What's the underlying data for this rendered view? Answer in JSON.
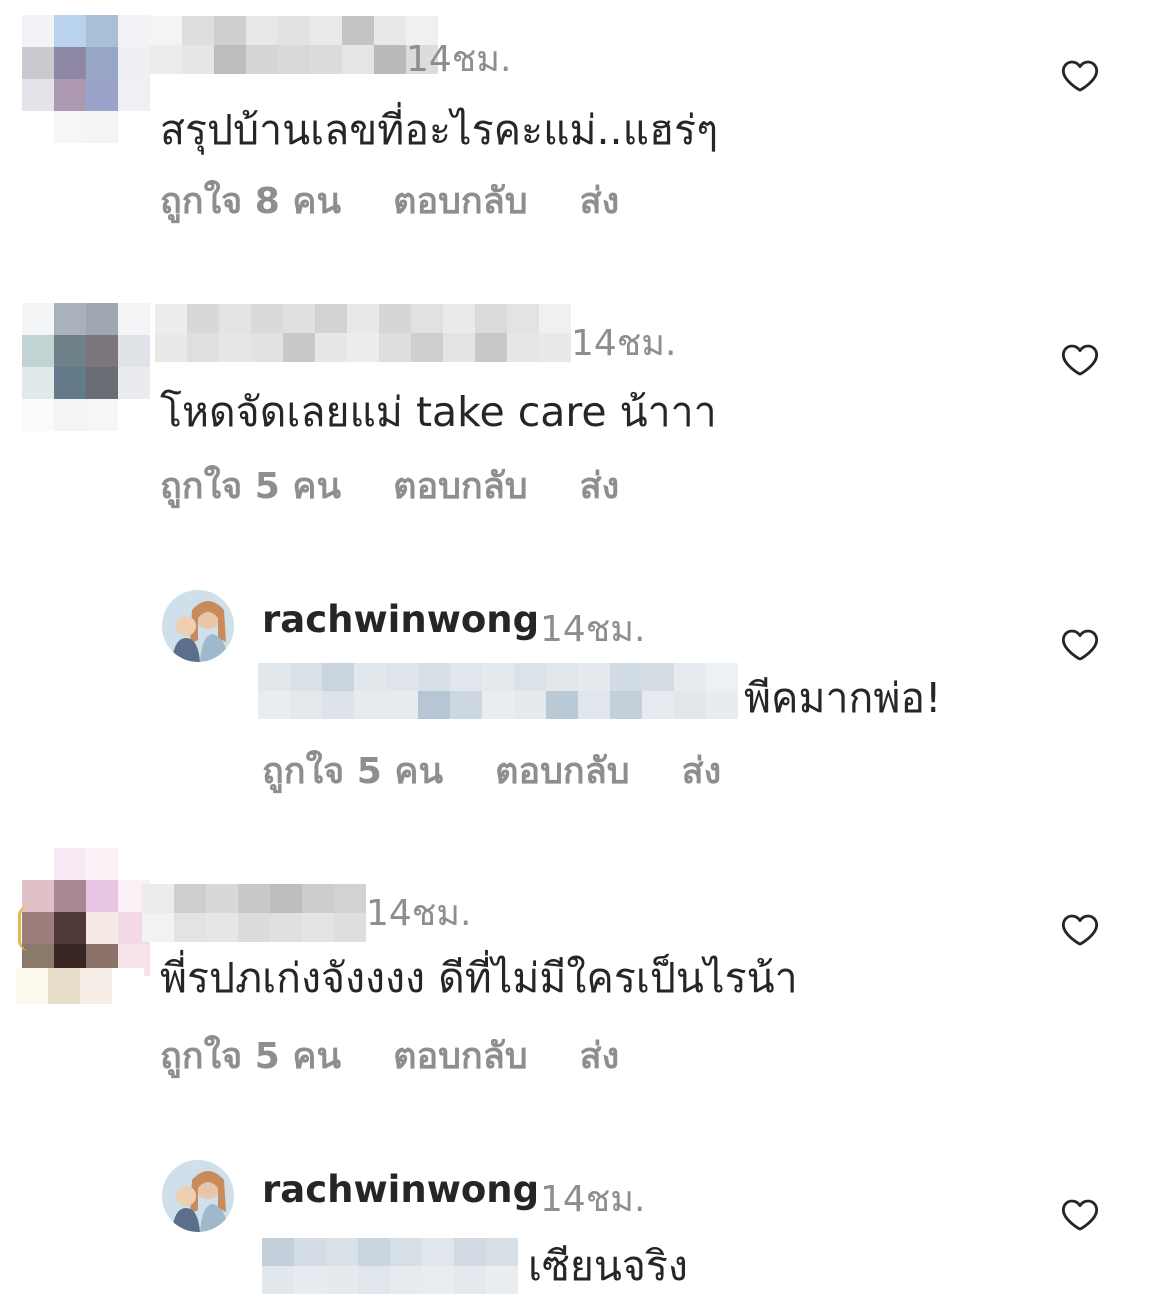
{
  "comments": [
    {
      "time": "14ชม.",
      "text": "สรุปบ้านเลขที่อะไรคะแม่..แฮร่ๆ",
      "likes": "ถูกใจ 8 คน",
      "reply": "ตอบกลับ",
      "send": "ส่ง"
    },
    {
      "time": "14ชม.",
      "text": "โหดจัดเลยแม่ take care น้าาา",
      "likes": "ถูกใจ 5 คน",
      "reply": "ตอบกลับ",
      "send": "ส่ง"
    },
    {
      "username": "rachwinwong",
      "time": "14ชม.",
      "text": "พีคมากพ่อ!",
      "likes": "ถูกใจ 5 คน",
      "reply": "ตอบกลับ",
      "send": "ส่ง"
    },
    {
      "time": "14ชม.",
      "text": "พี่รปภเก่งจังงงง ดีที่ไม่มีใครเป็นไรน้า",
      "likes": "ถูกใจ 5 คน",
      "reply": "ตอบกลับ",
      "send": "ส่ง"
    },
    {
      "username": "rachwinwong",
      "time": "14ชม.",
      "text": "เซียนจริง"
    }
  ],
  "icons": {
    "like": "heart-outline-icon"
  },
  "colors": {
    "primary_text": "#262626",
    "secondary_text": "#8e8e8e"
  }
}
